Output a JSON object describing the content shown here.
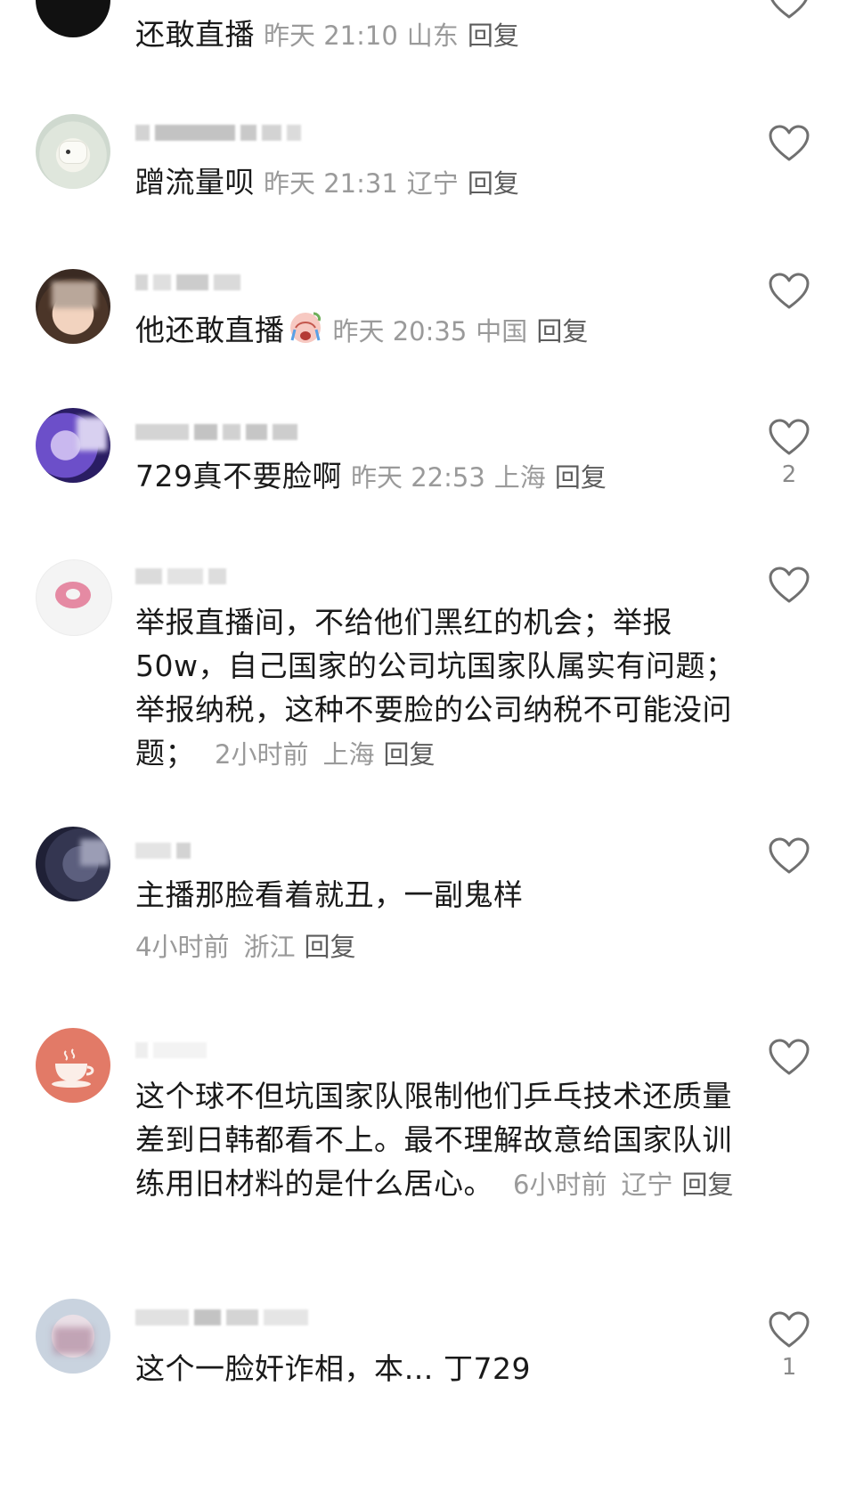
{
  "comments": [
    {
      "text": "还敢直播",
      "time": "昨天 21:10",
      "location": "山东",
      "reply": "回复",
      "likes": ""
    },
    {
      "text": "蹭流量呗",
      "time": "昨天 21:31",
      "location": "辽宁",
      "reply": "回复",
      "likes": ""
    },
    {
      "text": "他还敢直播",
      "time": "昨天 20:35",
      "location": "中国",
      "reply": "回复",
      "likes": ""
    },
    {
      "text": "729真不要脸啊",
      "time": "昨天 22:53",
      "location": "上海",
      "reply": "回复",
      "likes": "2"
    },
    {
      "text": "举报直播间，不给他们黑红的机会；举报50w，自己国家的公司坑国家队属实有问题；举报纳税，这种不要脸的公司纳税不可能没问题；",
      "time": "2小时前",
      "location": "上海",
      "reply": "回复",
      "likes": ""
    },
    {
      "text": "主播那脸看着就丑，一副鬼样",
      "time": "4小时前",
      "location": "浙江",
      "reply": "回复",
      "likes": ""
    },
    {
      "text": "这个球不但坑国家队限制他们乒乓技术还质量差到日韩都看不上。最不理解故意给国家队训练用旧材料的是什么居心。",
      "time": "6小时前",
      "location": "辽宁",
      "reply": "回复",
      "likes": ""
    },
    {
      "text": "这个一脸奸诈相，本… 丁729",
      "time": "",
      "location": "",
      "reply": "",
      "likes": "1"
    }
  ],
  "icons": {
    "like": "heart-outline-icon",
    "emoji": "crying-face-emoji-icon"
  },
  "colors": {
    "text": "#1a1a1a",
    "meta": "#9a9a9a",
    "reply": "#5c5c5c",
    "icon": "#707070"
  }
}
